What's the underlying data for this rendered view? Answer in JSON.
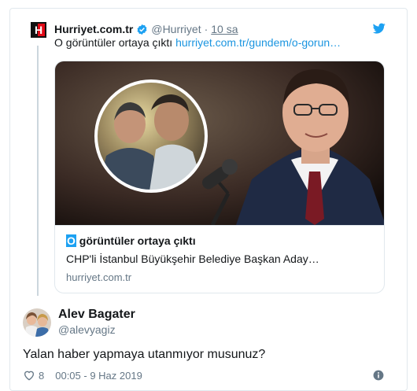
{
  "parent": {
    "account_name": "Hurriyet.com.tr",
    "handle": "@Hurriyet",
    "separator": "·",
    "time": "10 sa",
    "text": "O görüntüler ortaya çıktı",
    "link": "hurriyet.com.tr/gundem/o-gorun…",
    "logo_letter": "H",
    "icons": {
      "verified": "verified-badge-icon",
      "platform": "twitter-bird-icon"
    }
  },
  "card": {
    "title_highlight": "O",
    "title_rest": " görüntüler ortaya çıktı",
    "description": "CHP'li İstanbul Büyükşehir Belediye Başkan Aday…",
    "domain": "hurriyet.com.tr"
  },
  "reply": {
    "name": "Alev Bagater",
    "handle": "@alevyagiz",
    "text": "Yalan haber yapmaya utanmıyor musunuz?",
    "likes": "8",
    "timestamp": "00:05 - 9 Haz 2019",
    "icons": {
      "like": "heart-icon",
      "info": "info-icon"
    }
  },
  "colors": {
    "link": "#1b95e0",
    "accent": "#1da1f2",
    "muted": "#657786",
    "border": "#e1e8ed",
    "logo_red": "#e30a17"
  }
}
